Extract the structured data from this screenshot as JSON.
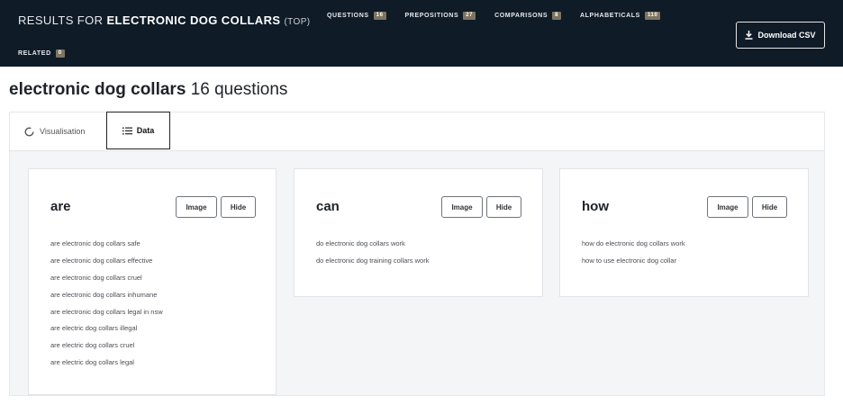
{
  "header": {
    "results_prefix": "RESULTS FOR",
    "keyword": "ELECTRONIC DOG COLLARS",
    "mode": "(TOP)",
    "nav": [
      {
        "label": "QUESTIONS",
        "count": "16"
      },
      {
        "label": "PREPOSITIONS",
        "count": "27"
      },
      {
        "label": "COMPARISONS",
        "count": "8"
      },
      {
        "label": "ALPHABETICALS",
        "count": "110"
      }
    ],
    "related": {
      "label": "RELATED",
      "count": "0"
    },
    "download_label": "Download CSV"
  },
  "page": {
    "keyword": "electronic dog collars",
    "count_text": "16 questions"
  },
  "tabs": [
    {
      "label": "Visualisation"
    },
    {
      "label": "Data"
    }
  ],
  "cards": [
    {
      "title": "are",
      "image_label": "Image",
      "hide_label": "Hide",
      "items": [
        "are electronic dog collars safe",
        "are electronic dog collars effective",
        "are electronic dog collars cruel",
        "are electronic dog collars inhumane",
        "are electronic dog collars legal in nsw",
        "are electric dog collars illegal",
        "are electric dog collars cruel",
        "are electric dog collars legal"
      ]
    },
    {
      "title": "can",
      "image_label": "Image",
      "hide_label": "Hide",
      "items": [
        "do electronic dog collars work",
        "do electronic dog training collars work"
      ]
    },
    {
      "title": "how",
      "image_label": "Image",
      "hide_label": "Hide",
      "items": [
        "how do electronic dog collars work",
        "how to use electronic dog collar"
      ]
    }
  ]
}
